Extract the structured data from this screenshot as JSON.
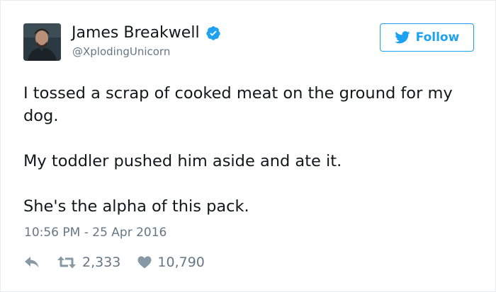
{
  "tweet": {
    "author": {
      "name": "James Breakwell",
      "handle": "@XplodingUnicorn",
      "verified": true,
      "avatar_icon": "user-avatar-photo"
    },
    "follow_label": "Follow",
    "paragraphs": [
      "I tossed a scrap of cooked meat on the ground for my dog.",
      "My toddler pushed him aside and ate it.",
      "She's the alpha of this pack."
    ],
    "timestamp": "10:56 PM - 25 Apr 2016",
    "stats": {
      "retweets": "2,333",
      "likes": "10,790"
    }
  },
  "colors": {
    "twitter_blue": "#1da1f2",
    "text_primary": "#14171a",
    "text_secondary": "#657786",
    "border": "#e6ecf0"
  },
  "icons": {
    "verified": "verified-badge-icon",
    "bird": "twitter-bird-icon",
    "reply": "reply-icon",
    "retweet": "retweet-icon",
    "like": "heart-icon"
  }
}
